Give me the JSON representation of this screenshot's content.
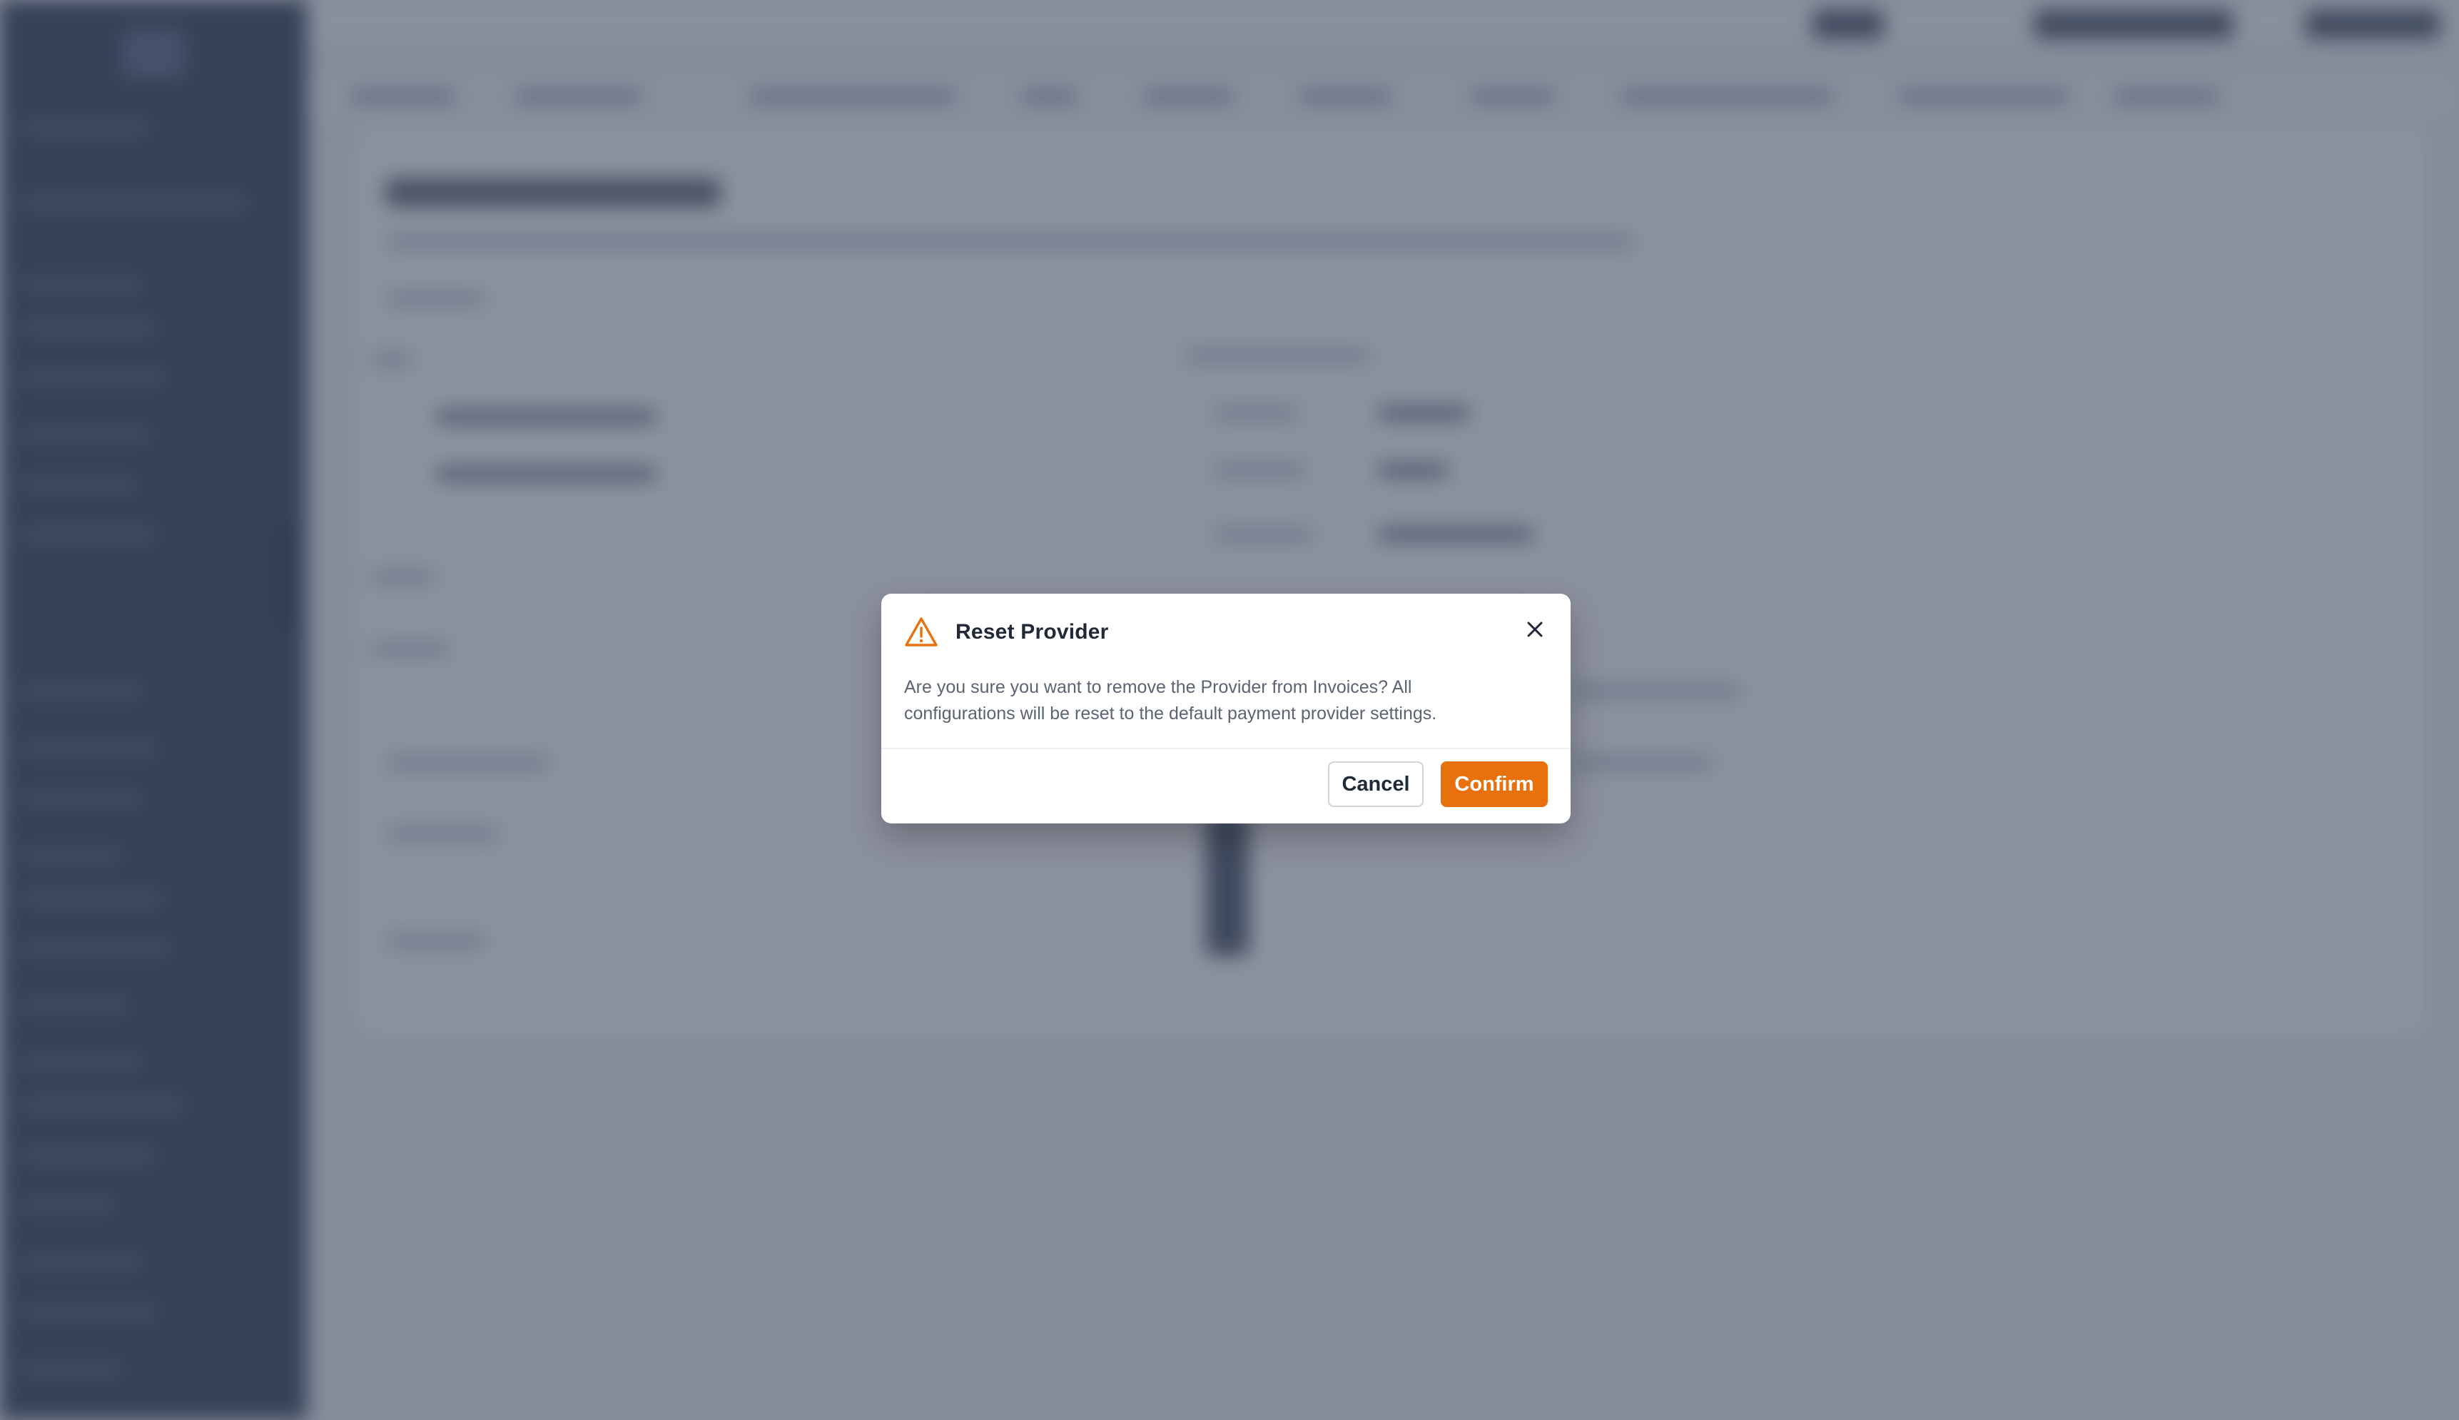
{
  "dialog": {
    "title": "Reset Provider",
    "icon": "warning-triangle-icon",
    "close_icon": "close-icon",
    "message": "Are you sure you want to remove the Provider from Invoices? All configurations will be reset to the default payment provider settings.",
    "cancel_label": "Cancel",
    "confirm_label": "Confirm"
  },
  "colors": {
    "accent": "#e8710e",
    "overlay": "#374155",
    "sidebar": "#34435a"
  }
}
